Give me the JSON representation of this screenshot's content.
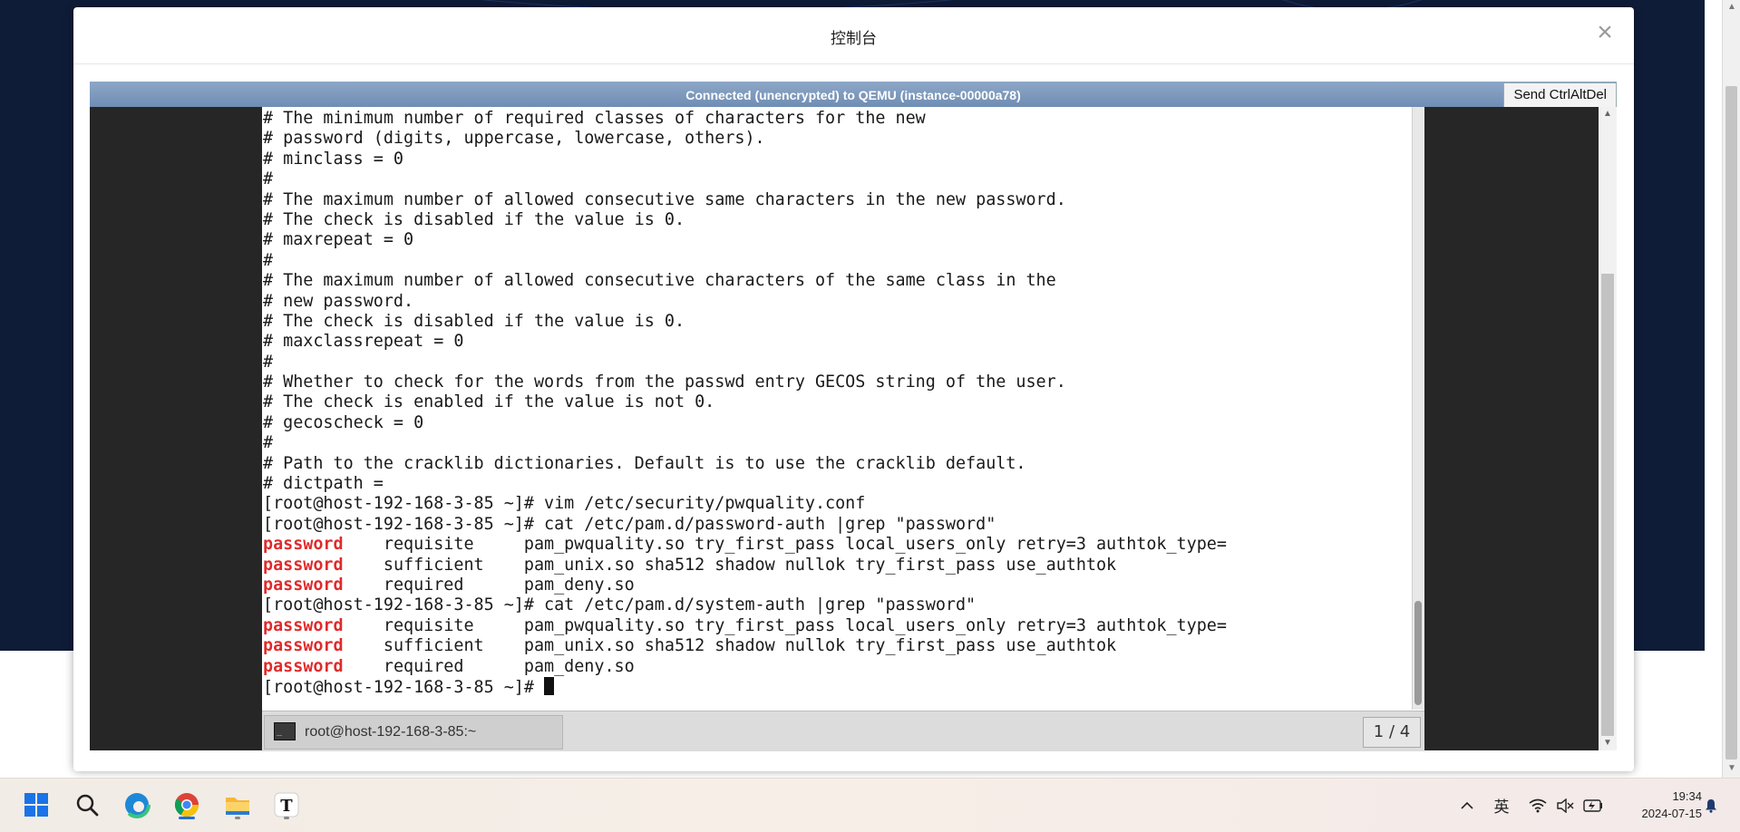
{
  "modal": {
    "title": "控制台",
    "close_label": "×"
  },
  "vnc": {
    "status": "Connected (unencrypted) to QEMU (instance-00000a78)",
    "send_button": "Send CtrlAltDel"
  },
  "terminal": {
    "lines": [
      "# The minimum number of required classes of characters for the new",
      "# password (digits, uppercase, lowercase, others).",
      "# minclass = 0",
      "#",
      "# The maximum number of allowed consecutive same characters in the new password.",
      "# The check is disabled if the value is 0.",
      "# maxrepeat = 0",
      "#",
      "# The maximum number of allowed consecutive characters of the same class in the",
      "# new password.",
      "# The check is disabled if the value is 0.",
      "# maxclassrepeat = 0",
      "#",
      "# Whether to check for the words from the passwd entry GECOS string of the user.",
      "# The check is enabled if the value is not 0.",
      "# gecoscheck = 0",
      "#",
      "# Path to the cracklib dictionaries. Default is to use the cracklib default.",
      "# dictpath =",
      "[root@host-192-168-3-85 ~]# vim /etc/security/pwquality.conf",
      "[root@host-192-168-3-85 ~]# cat /etc/pam.d/password-auth |grep \"password\""
    ],
    "grep1": [
      {
        "kw": "password",
        "rest": "    requisite     pam_pwquality.so try_first_pass local_users_only retry=3 authtok_type="
      },
      {
        "kw": "password",
        "rest": "    sufficient    pam_unix.so sha512 shadow nullok try_first_pass use_authtok"
      },
      {
        "kw": "password",
        "rest": "    required      pam_deny.so"
      }
    ],
    "cmd2": "[root@host-192-168-3-85 ~]# cat /etc/pam.d/system-auth |grep \"password\"",
    "grep2": [
      {
        "kw": "password",
        "rest": "    requisite     pam_pwquality.so try_first_pass local_users_only retry=3 authtok_type="
      },
      {
        "kw": "password",
        "rest": "    sufficient    pam_unix.so sha512 shadow nullok try_first_pass use_authtok"
      },
      {
        "kw": "password",
        "rest": "    required      pam_deny.so"
      }
    ],
    "prompt": "[root@host-192-168-3-85 ~]# ",
    "tab_label": "root@host-192-168-3-85:~",
    "pager": "1 / 4"
  },
  "taskbar": {
    "apps": [
      "start",
      "search",
      "edge",
      "chrome",
      "file-explorer",
      "typora"
    ],
    "ime": "英",
    "time": "19:34",
    "date": "2024-07-15"
  },
  "colors": {
    "keyword": "#e02b2b",
    "vnc_status_bg": "#7f9bbf",
    "background_navy": "#0f1c38"
  }
}
